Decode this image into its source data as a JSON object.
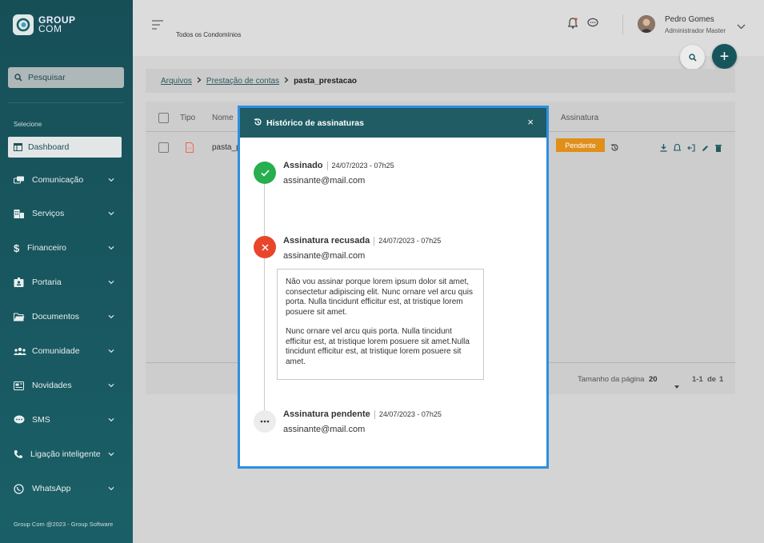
{
  "colors": {
    "sidebar": "#1a5a62",
    "accent": "#1f5c64",
    "pending": "#e08f1b",
    "success": "#27ae4f",
    "danger": "#e8452b",
    "modal_border": "#2f8fe0"
  },
  "sidebar": {
    "logo_line1": "GROUP",
    "logo_line2": "COM",
    "search_label": "Pesquisar",
    "section_label": "Selecione",
    "dashboard_label": "Dashboard",
    "items": [
      {
        "label": "Comunicação",
        "icon": "chat-icon"
      },
      {
        "label": "Serviços",
        "icon": "building-icon"
      },
      {
        "label": "Financeiro",
        "icon": "dollar-icon"
      },
      {
        "label": "Portaria",
        "icon": "badge-icon"
      },
      {
        "label": "Documentos",
        "icon": "folder-icon"
      },
      {
        "label": "Comunidade",
        "icon": "people-icon"
      },
      {
        "label": "Novidades",
        "icon": "news-icon"
      },
      {
        "label": "SMS",
        "icon": "sms-icon"
      },
      {
        "label": "Ligação inteligente",
        "icon": "phone-icon"
      },
      {
        "label": "WhatsApp",
        "icon": "whatsapp-icon"
      }
    ],
    "footer": "Group Com @2023 - Group Software"
  },
  "header": {
    "condominium": "Todos os Condomínios",
    "user_name": "Pedro Gomes",
    "user_role": "Administrador Master"
  },
  "breadcrumb": {
    "items": [
      "Arquivos",
      "Prestação de contas"
    ],
    "current": "pasta_prestacao"
  },
  "table": {
    "headers": {
      "tipo": "Tipo",
      "nome": "Nome",
      "assinatura": "Assinatura"
    },
    "row": {
      "name": "pasta_p",
      "status": "Pendente"
    },
    "pager": {
      "page_size_label": "Tamanho da página",
      "page_size": "20",
      "range": "1-1",
      "of_label": "de",
      "total": "1"
    }
  },
  "modal": {
    "title": "Histórico de assinaturas",
    "close_glyph": "×",
    "events": [
      {
        "status": "Assinado",
        "datetime": "24/07/2023 - 07h25",
        "email": "assinante@mail.com"
      },
      {
        "status": "Assinatura recusada",
        "datetime": "24/07/2023 - 07h25",
        "email": "assinante@mail.com",
        "note_p1": "Não vou assinar porque lorem ipsum dolor sit amet, consectetur adipiscing elit. Nunc ornare vel arcu quis porta. Nulla tincidunt efficitur est, at tristique lorem posuere sit amet.",
        "note_p2": "Nunc ornare vel arcu quis porta. Nulla tincidunt efficitur est, at tristique lorem posuere sit amet.Nulla tincidunt efficitur est, at tristique lorem posuere sit amet."
      },
      {
        "status": "Assinatura pendente",
        "datetime": "24/07/2023 - 07h25",
        "email": "assinante@mail.com"
      }
    ]
  }
}
